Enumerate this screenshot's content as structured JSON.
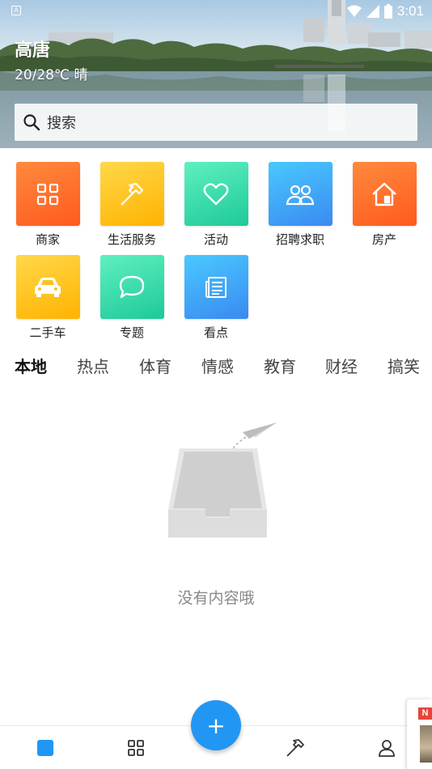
{
  "status": {
    "time": "3:01",
    "notification_glyph": "A"
  },
  "header": {
    "city": "高唐",
    "weather": "20/28℃  晴"
  },
  "search": {
    "label": "搜索"
  },
  "categories": [
    {
      "label": "商家",
      "icon": "grid-icon",
      "gradient": [
        "#ff8a3d",
        "#ff5a1f"
      ]
    },
    {
      "label": "生活服务",
      "icon": "hammer-icon",
      "gradient": [
        "#ffd84a",
        "#ffb300"
      ]
    },
    {
      "label": "活动",
      "icon": "heart-icon",
      "gradient": [
        "#5ff0c0",
        "#1ec99a"
      ]
    },
    {
      "label": "招聘求职",
      "icon": "people-icon",
      "gradient": [
        "#49c9ff",
        "#3a8af0"
      ]
    },
    {
      "label": "房产",
      "icon": "house-icon",
      "gradient": [
        "#ff8a3d",
        "#ff5a1f"
      ]
    },
    {
      "label": "二手车",
      "icon": "car-icon",
      "gradient": [
        "#ffd84a",
        "#ffb300"
      ]
    },
    {
      "label": "专题",
      "icon": "chat-bubble-icon",
      "gradient": [
        "#5ff0c0",
        "#1ec99a"
      ]
    },
    {
      "label": "看点",
      "icon": "newspaper-icon",
      "gradient": [
        "#49c9ff",
        "#3a8af0"
      ]
    }
  ],
  "tabs": [
    "本地",
    "热点",
    "体育",
    "情感",
    "教育",
    "财经",
    "搞笑"
  ],
  "active_tab": "本地",
  "empty_state": {
    "message": "没有内容哦"
  },
  "bottom_nav": {
    "fab_label": "+",
    "items": [
      "home-icon",
      "grid-icon",
      "hammer-icon",
      "user-icon"
    ],
    "accent": "#2196f3"
  },
  "ad": {
    "badge": "N"
  }
}
